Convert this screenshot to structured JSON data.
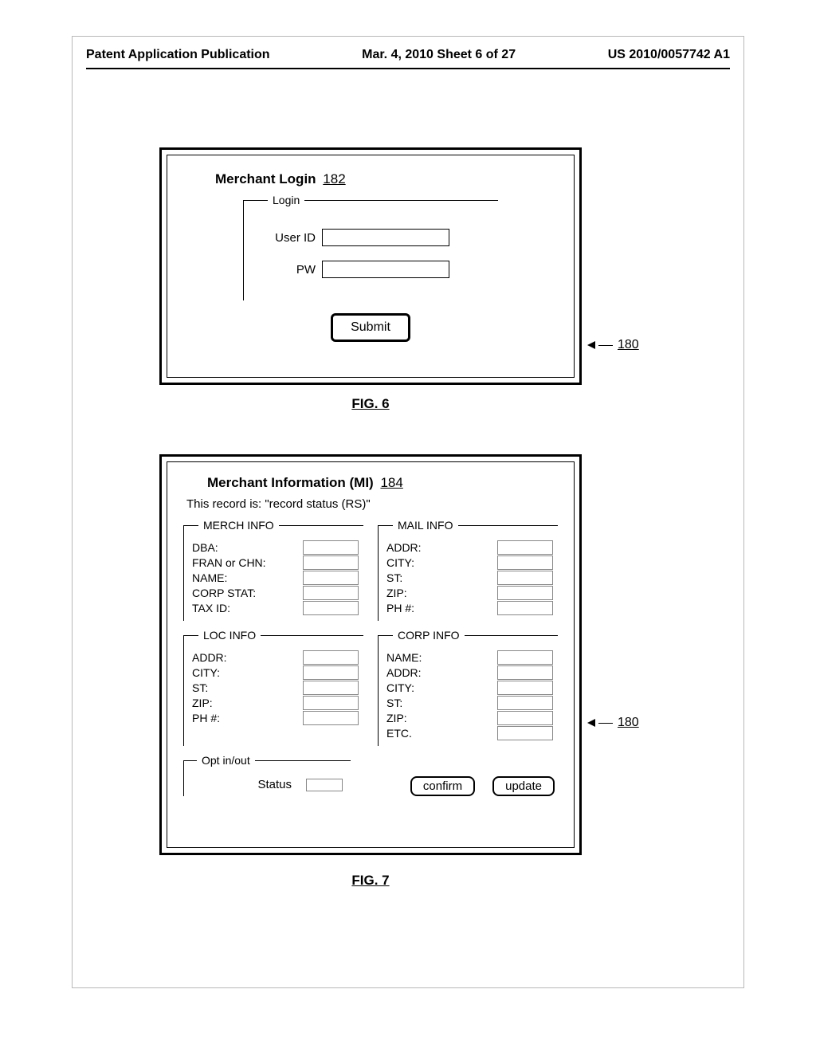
{
  "header": {
    "left": "Patent Application Publication",
    "center": "Mar. 4, 2010  Sheet 6 of 27",
    "right": "US 2010/0057742 A1"
  },
  "fig6": {
    "title": "Merchant Login",
    "title_ref": "182",
    "group_legend": "Login",
    "userid_label": "User ID",
    "pw_label": "PW",
    "submit_label": "Submit",
    "callout": "180",
    "caption": "FIG. 6"
  },
  "fig7": {
    "title": "Merchant Information (MI)",
    "title_ref": "184",
    "record_text": "This record is: \"record status (RS)\"",
    "merch": {
      "legend": "MERCH INFO",
      "fields": [
        "DBA:",
        "FRAN or CHN:",
        "NAME:",
        "CORP STAT:",
        "TAX ID:"
      ]
    },
    "mail": {
      "legend": "MAIL INFO",
      "fields": [
        "ADDR:",
        "CITY:",
        "ST:",
        "ZIP:",
        "PH #:"
      ]
    },
    "loc": {
      "legend": "LOC INFO",
      "fields": [
        "ADDR:",
        "CITY:",
        "ST:",
        "ZIP:",
        "PH #:"
      ]
    },
    "corp": {
      "legend": "CORP INFO",
      "fields": [
        "NAME:",
        "ADDR:",
        "CITY:",
        "ST:",
        "ZIP:",
        "ETC."
      ]
    },
    "opt": {
      "legend": "Opt in/out",
      "status_label": "Status"
    },
    "confirm_label": "confirm",
    "update_label": "update",
    "callout": "180",
    "caption": "FIG. 7"
  }
}
